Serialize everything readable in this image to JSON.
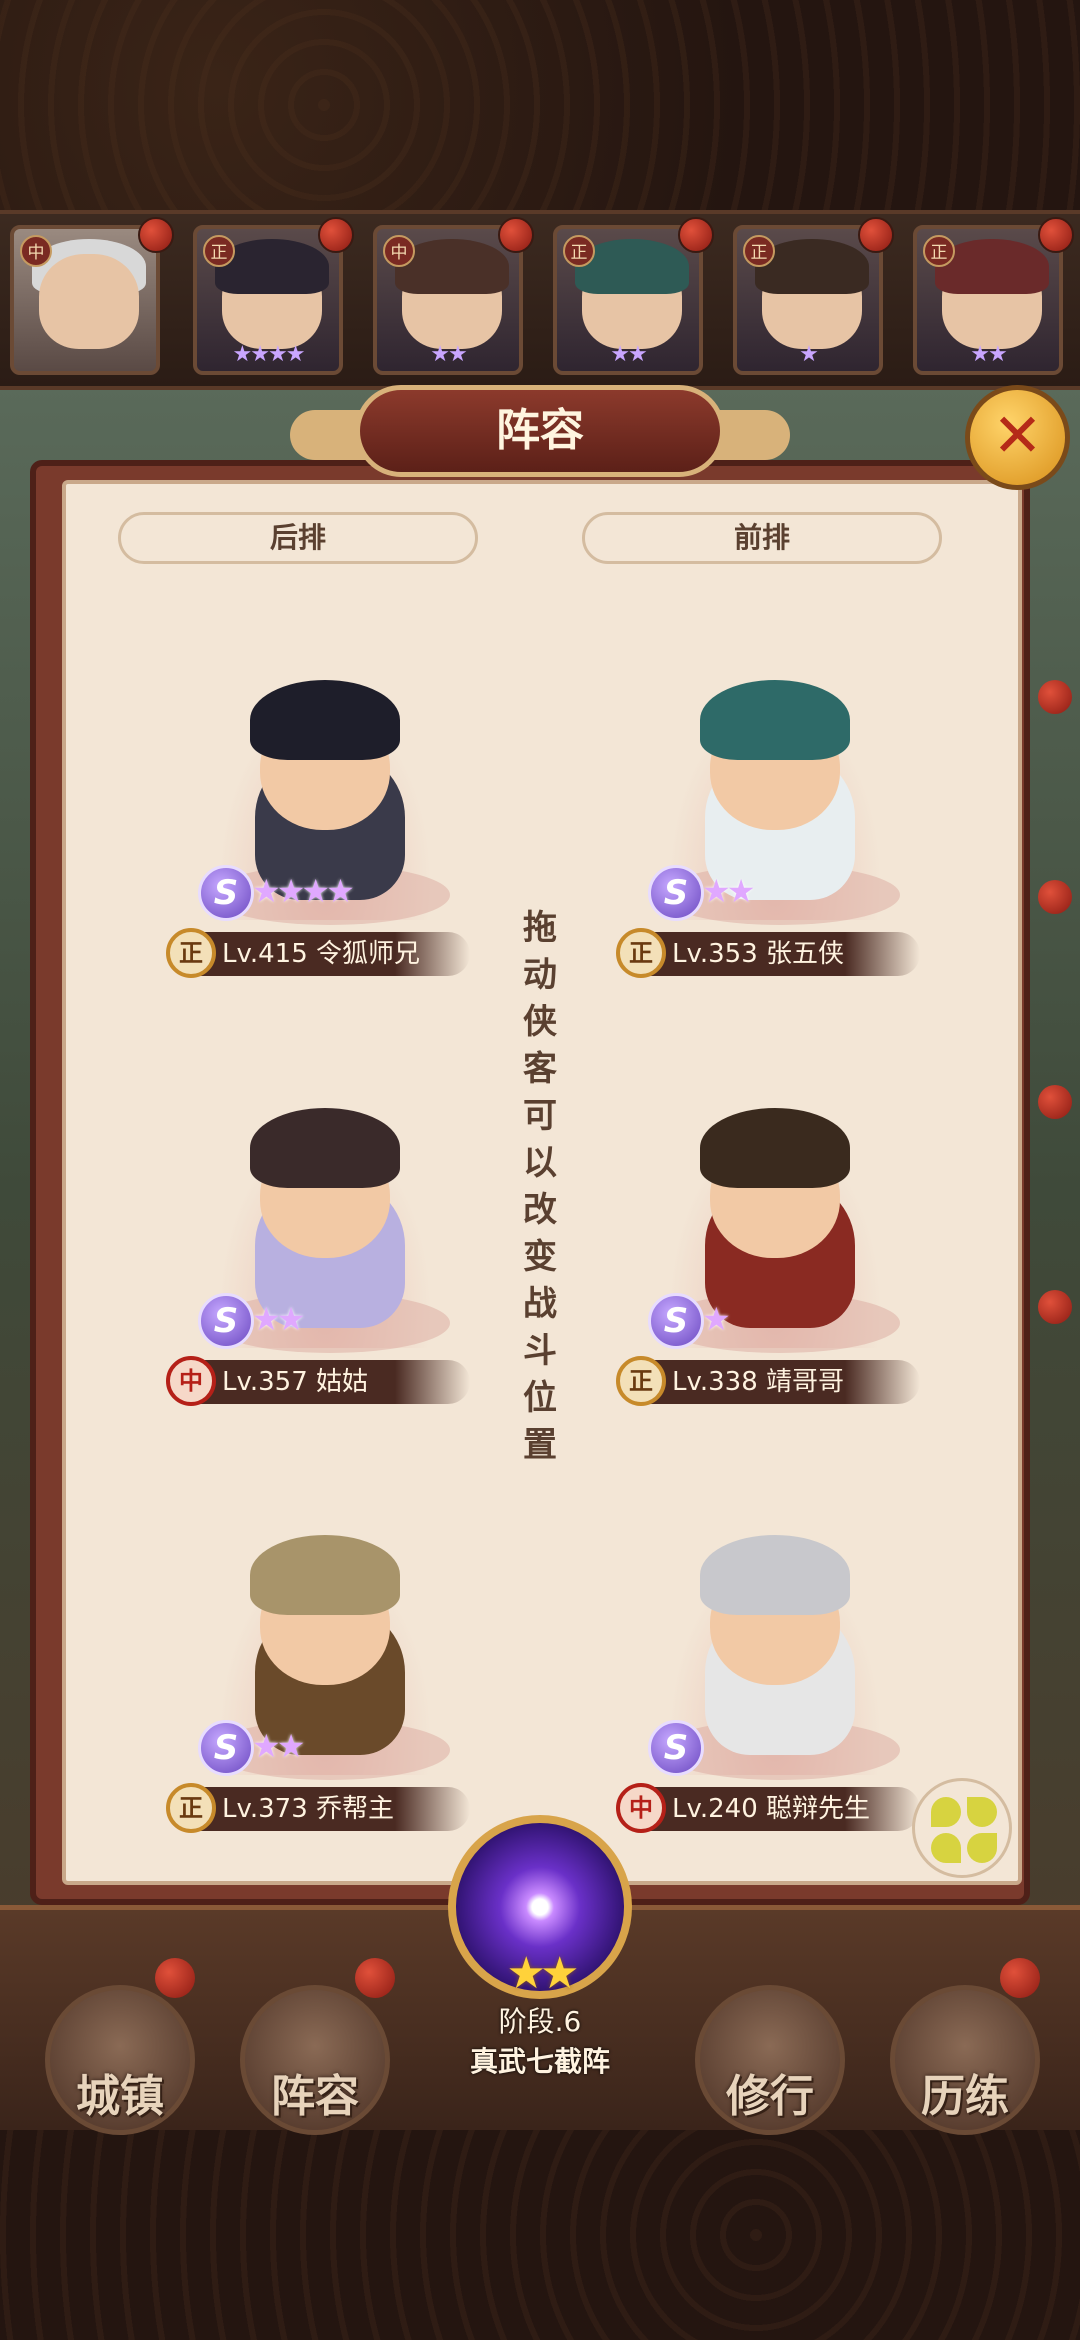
{
  "panel": {
    "title": "阵容",
    "close_icon": "close-icon",
    "rows": {
      "back": "后排",
      "front": "前排"
    },
    "hint": "拖动侠客可以改变战斗位置"
  },
  "hero_strip": [
    {
      "badge": "中",
      "stars": "",
      "selected": true
    },
    {
      "badge": "正",
      "stars": "★★★★"
    },
    {
      "badge": "中",
      "stars": "★★"
    },
    {
      "badge": "正",
      "stars": "★★"
    },
    {
      "badge": "正",
      "stars": "★"
    },
    {
      "badge": "正",
      "stars": "★★"
    }
  ],
  "slots": [
    {
      "class": "正",
      "level": "Lv.415",
      "name": "令狐师兄",
      "stars": "★★★★",
      "rank": "S"
    },
    {
      "class": "正",
      "level": "Lv.353",
      "name": "张五侠",
      "stars": "★★",
      "rank": "S"
    },
    {
      "class": "中",
      "level": "Lv.357",
      "name": "姑姑",
      "stars": "★★",
      "rank": "S"
    },
    {
      "class": "正",
      "level": "Lv.338",
      "name": "靖哥哥",
      "stars": "★",
      "rank": "S"
    },
    {
      "class": "正",
      "level": "Lv.373",
      "name": "乔帮主",
      "stars": "★★",
      "rank": "S"
    },
    {
      "class": "中",
      "level": "Lv.240",
      "name": "聪辩先生",
      "stars": "",
      "rank": "S"
    }
  ],
  "formation": {
    "stars": "★★",
    "stage": "阶段.6",
    "name": "真武七截阵"
  },
  "bottom_nav": [
    {
      "label": "城镇"
    },
    {
      "label": "阵容"
    },
    {
      "label": "修行"
    },
    {
      "label": "历练"
    }
  ],
  "colors": {
    "panel_bg": "#f3e6d6",
    "frame": "#7a3a2c",
    "accent_gold": "#d8b27a"
  }
}
